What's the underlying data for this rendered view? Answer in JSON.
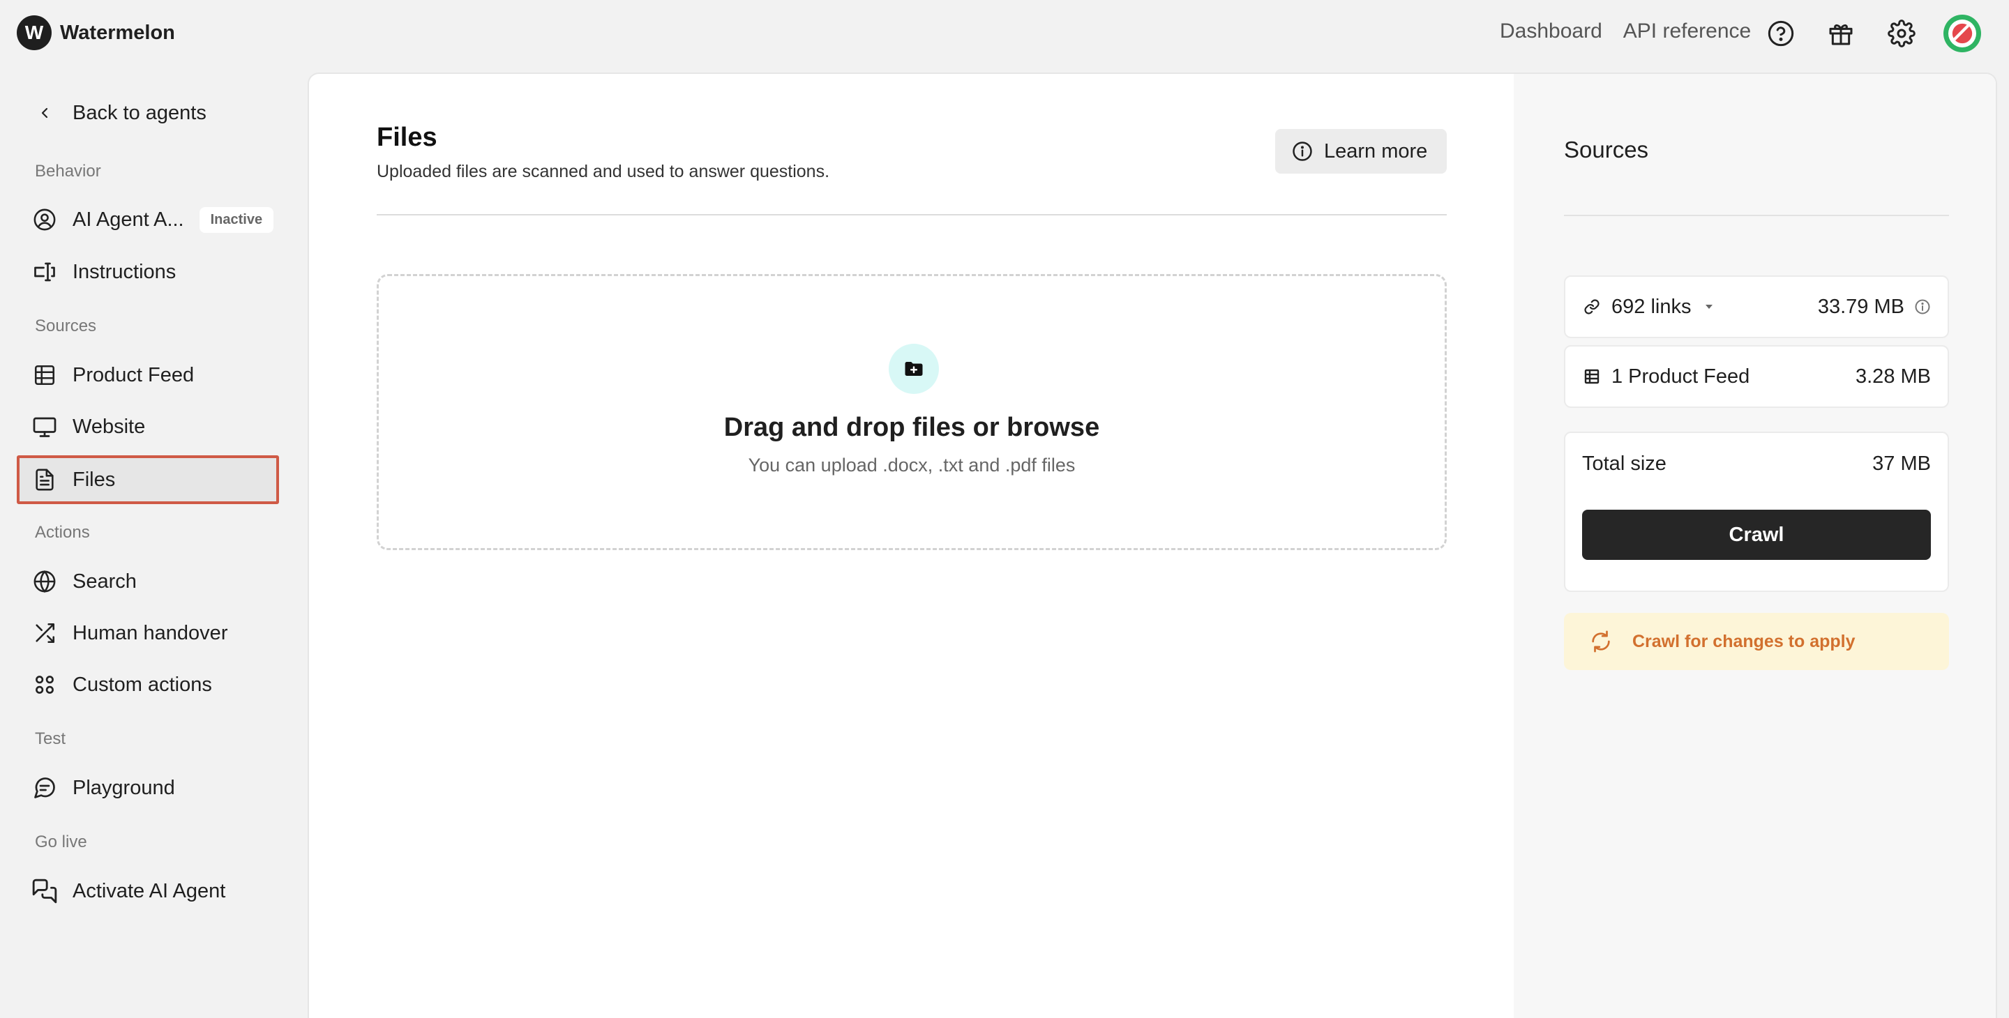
{
  "brand": {
    "logo_letter": "W",
    "name": "Watermelon"
  },
  "topnav": {
    "dashboard": "Dashboard",
    "api_reference": "API reference"
  },
  "icons": {
    "help": "help-circle-icon",
    "gift": "gift-icon",
    "settings": "gear-icon",
    "avatar": "watermelon-avatar"
  },
  "sidebar": {
    "back": "Back to agents",
    "sections": {
      "behavior": "Behavior",
      "sources": "Sources",
      "actions": "Actions",
      "test": "Test",
      "go_live": "Go live"
    },
    "items": {
      "ai_agent": {
        "label": "AI Agent A...",
        "badge": "Inactive"
      },
      "instructions": {
        "label": "Instructions"
      },
      "product_feed": {
        "label": "Product Feed"
      },
      "website": {
        "label": "Website"
      },
      "files": {
        "label": "Files"
      },
      "search": {
        "label": "Search"
      },
      "human_handover": {
        "label": "Human handover"
      },
      "custom_actions": {
        "label": "Custom actions"
      },
      "playground": {
        "label": "Playground"
      },
      "activate": {
        "label": "Activate AI Agent"
      }
    },
    "selected": "files"
  },
  "main": {
    "title": "Files",
    "subtitle": "Uploaded files are scanned and used to answer questions.",
    "learn_more": "Learn more",
    "dropzone": {
      "title": "Drag and drop files or browse",
      "subtitle": "You can upload .docx, .txt and .pdf files"
    }
  },
  "sources": {
    "title": "Sources",
    "links": {
      "label": "692 links",
      "size": "33.79 MB"
    },
    "product_feed": {
      "label": "1 Product Feed",
      "size": "3.28 MB"
    },
    "total": {
      "label": "Total size",
      "value": "37 MB"
    },
    "crawl_button": "Crawl",
    "notice": "Crawl for changes to apply"
  },
  "colors": {
    "accent_selected_border": "#cf5a46",
    "notice_text": "#d2702e",
    "notice_bg": "#fdf5d8",
    "avatar_green": "#2fb463",
    "avatar_red": "#e5484d"
  }
}
